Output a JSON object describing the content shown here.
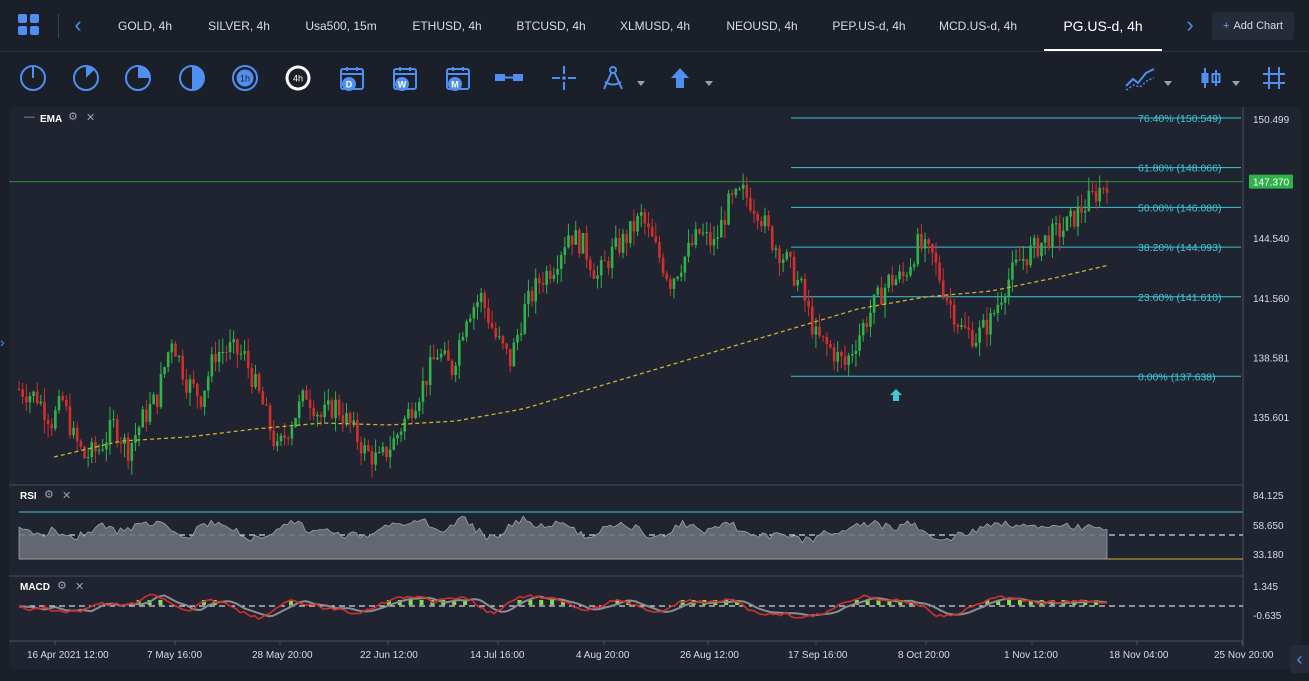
{
  "tabs": [
    {
      "label": "GOLD, 4h"
    },
    {
      "label": "SILVER, 4h"
    },
    {
      "label": "Usa500, 15m"
    },
    {
      "label": "ETHUSD, 4h"
    },
    {
      "label": "BTCUSD, 4h"
    },
    {
      "label": "XLMUSD, 4h"
    },
    {
      "label": "NEOUSD, 4h"
    },
    {
      "label": "PEP.US-d, 4h"
    },
    {
      "label": "MCD.US-d, 4h"
    },
    {
      "label": "PG.US-d, 4h",
      "active": true
    }
  ],
  "add_chart": {
    "plus": "+",
    "label": "Add Chart"
  },
  "toolbar": {
    "timeframe_icons": [
      "clock-quarter-icon",
      "clock-eighth-icon",
      "clock-quarter-filled-icon",
      "clock-half-icon",
      "clock-1h-icon",
      "clock-4h-icon"
    ],
    "timeframe_labels": {
      "h1": "1h",
      "h4": "4h"
    },
    "calendar_labels": [
      "D",
      "W",
      "M"
    ],
    "accent": "#4f8ff0"
  },
  "indicators": {
    "main": "EMA",
    "rsi": "RSI",
    "macd": "MACD"
  },
  "chart_data": {
    "type": "candlestick",
    "symbol": "PG.US-d, 4h",
    "price_axis": {
      "ticks": [
        "150.499",
        "144.540",
        "141.560",
        "138.581",
        "135.601"
      ],
      "ylim": [
        133.0,
        151.4
      ]
    },
    "current_price": "147.370",
    "time_axis": [
      "16 Apr 2021 12:00",
      "7 May 16:00",
      "28 May 20:00",
      "22 Jun 12:00",
      "14 Jul 16:00",
      "4 Aug 20:00",
      "26 Aug 12:00",
      "17 Sep 16:00",
      "8 Oct 20:00",
      "1 Nov 12:00",
      "18 Nov 04:00",
      "25 Nov 20:00"
    ],
    "fibonacci": [
      {
        "label": "76.40% (150.549)",
        "price": 150.549
      },
      {
        "label": "61.80% (148.066)",
        "price": 148.066
      },
      {
        "label": "50.00% (146.080)",
        "price": 146.08
      },
      {
        "label": "38.20% (144.093)",
        "price": 144.093
      },
      {
        "label": "23.60% (141.610)",
        "price": 141.61
      },
      {
        "label": "0.00% (137.638)",
        "price": 137.638
      }
    ],
    "close_path": [
      [
        0,
        137.0
      ],
      [
        10,
        136.6
      ],
      [
        18,
        135.4
      ],
      [
        24,
        136.4
      ],
      [
        30,
        134.6
      ],
      [
        36,
        133.6
      ],
      [
        44,
        134.0
      ],
      [
        52,
        135.2
      ],
      [
        60,
        134.0
      ],
      [
        68,
        135.5
      ],
      [
        76,
        136.6
      ],
      [
        84,
        139.6
      ],
      [
        92,
        137.4
      ],
      [
        100,
        136.6
      ],
      [
        108,
        138.8
      ],
      [
        116,
        139.0
      ],
      [
        124,
        138.6
      ],
      [
        134,
        136.2
      ],
      [
        142,
        133.9
      ],
      [
        150,
        135.4
      ],
      [
        158,
        136.8
      ],
      [
        166,
        135.6
      ],
      [
        174,
        136.2
      ],
      [
        182,
        135.2
      ],
      [
        190,
        133.9
      ],
      [
        198,
        133.4
      ],
      [
        206,
        134.4
      ],
      [
        214,
        135.8
      ],
      [
        222,
        137.2
      ],
      [
        230,
        138.8
      ],
      [
        238,
        138.0
      ],
      [
        246,
        140.8
      ],
      [
        254,
        141.6
      ],
      [
        262,
        139.6
      ],
      [
        270,
        138.4
      ],
      [
        278,
        141.0
      ],
      [
        286,
        142.4
      ],
      [
        294,
        143.2
      ],
      [
        302,
        144.8
      ],
      [
        310,
        144.2
      ],
      [
        318,
        142.6
      ],
      [
        326,
        143.8
      ],
      [
        334,
        144.6
      ],
      [
        342,
        145.6
      ],
      [
        350,
        144.0
      ],
      [
        358,
        142.4
      ],
      [
        366,
        143.6
      ],
      [
        374,
        144.8
      ],
      [
        382,
        144.2
      ],
      [
        390,
        146.2
      ],
      [
        398,
        146.8
      ],
      [
        406,
        146.0
      ],
      [
        414,
        144.4
      ],
      [
        422,
        143.4
      ],
      [
        430,
        142.0
      ],
      [
        438,
        139.6
      ],
      [
        446,
        139.0
      ],
      [
        454,
        138.2
      ],
      [
        462,
        139.8
      ],
      [
        470,
        141.2
      ],
      [
        478,
        142.4
      ],
      [
        486,
        142.6
      ],
      [
        494,
        144.2
      ],
      [
        502,
        143.6
      ],
      [
        510,
        141.6
      ],
      [
        518,
        140.0
      ],
      [
        526,
        139.6
      ],
      [
        534,
        140.4
      ],
      [
        542,
        142.2
      ],
      [
        550,
        143.4
      ],
      [
        558,
        144.0
      ],
      [
        566,
        144.6
      ],
      [
        574,
        145.0
      ],
      [
        582,
        145.8
      ],
      [
        590,
        146.6
      ],
      [
        598,
        147.4
      ]
    ],
    "ema_path": [
      [
        0,
        133.6
      ],
      [
        40,
        134.4
      ],
      [
        80,
        134.6
      ],
      [
        120,
        135.0
      ],
      [
        160,
        135.3
      ],
      [
        200,
        135.2
      ],
      [
        240,
        135.4
      ],
      [
        280,
        136.0
      ],
      [
        320,
        137.0
      ],
      [
        360,
        138.0
      ],
      [
        400,
        139.0
      ],
      [
        440,
        140.0
      ],
      [
        480,
        141.0
      ],
      [
        520,
        141.6
      ],
      [
        560,
        141.9
      ],
      [
        600,
        142.6
      ],
      [
        630,
        143.2
      ]
    ],
    "rsi": {
      "ticks": [
        "84.125",
        "58.650",
        "33.180"
      ],
      "upper": 70,
      "lower": 30,
      "mid": 50
    },
    "macd": {
      "ticks": [
        "1.345",
        "-0.635"
      ]
    },
    "grid": false
  },
  "colors": {
    "bull": "#2fb24a",
    "bear": "#d0302d",
    "fib": "#3cc8d8",
    "ema": "#c9b230",
    "price_tag": "#2fb24a"
  }
}
